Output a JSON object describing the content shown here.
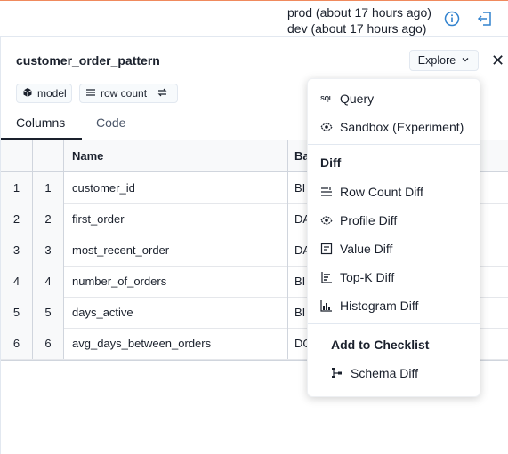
{
  "topbar": {
    "env_prod": "prod (about 17 hours ago)",
    "env_dev": "dev (about 17 hours ago)"
  },
  "panel": {
    "title": "customer_order_pattern",
    "explore_label": "Explore",
    "tags": {
      "model": "model",
      "row_count": "row count"
    },
    "tabs": [
      "Columns",
      "Code"
    ]
  },
  "table": {
    "headers": [
      "Name",
      "Ba"
    ],
    "rows": [
      {
        "idx": "1",
        "pos": "1",
        "name": "customer_id",
        "type": "BI"
      },
      {
        "idx": "2",
        "pos": "2",
        "name": "first_order",
        "type": "DA"
      },
      {
        "idx": "3",
        "pos": "3",
        "name": "most_recent_order",
        "type": "DA"
      },
      {
        "idx": "4",
        "pos": "4",
        "name": "number_of_orders",
        "type": "BI"
      },
      {
        "idx": "5",
        "pos": "5",
        "name": "days_active",
        "type": "BI"
      },
      {
        "idx": "6",
        "pos": "6",
        "name": "avg_days_between_orders",
        "type": "DO"
      }
    ]
  },
  "menu": {
    "query": "Query",
    "sandbox": "Sandbox (Experiment)",
    "diff_group": "Diff",
    "row_count_diff": "Row Count Diff",
    "profile_diff": "Profile Diff",
    "value_diff": "Value Diff",
    "topk_diff": "Top-K Diff",
    "histogram_diff": "Histogram Diff",
    "checklist_group": "Add to Checklist",
    "schema_diff": "Schema Diff",
    "sql_glyph": "SQL"
  },
  "colors": {
    "accent_line": "#f08a5d",
    "icon_blue": "#3182ce"
  }
}
